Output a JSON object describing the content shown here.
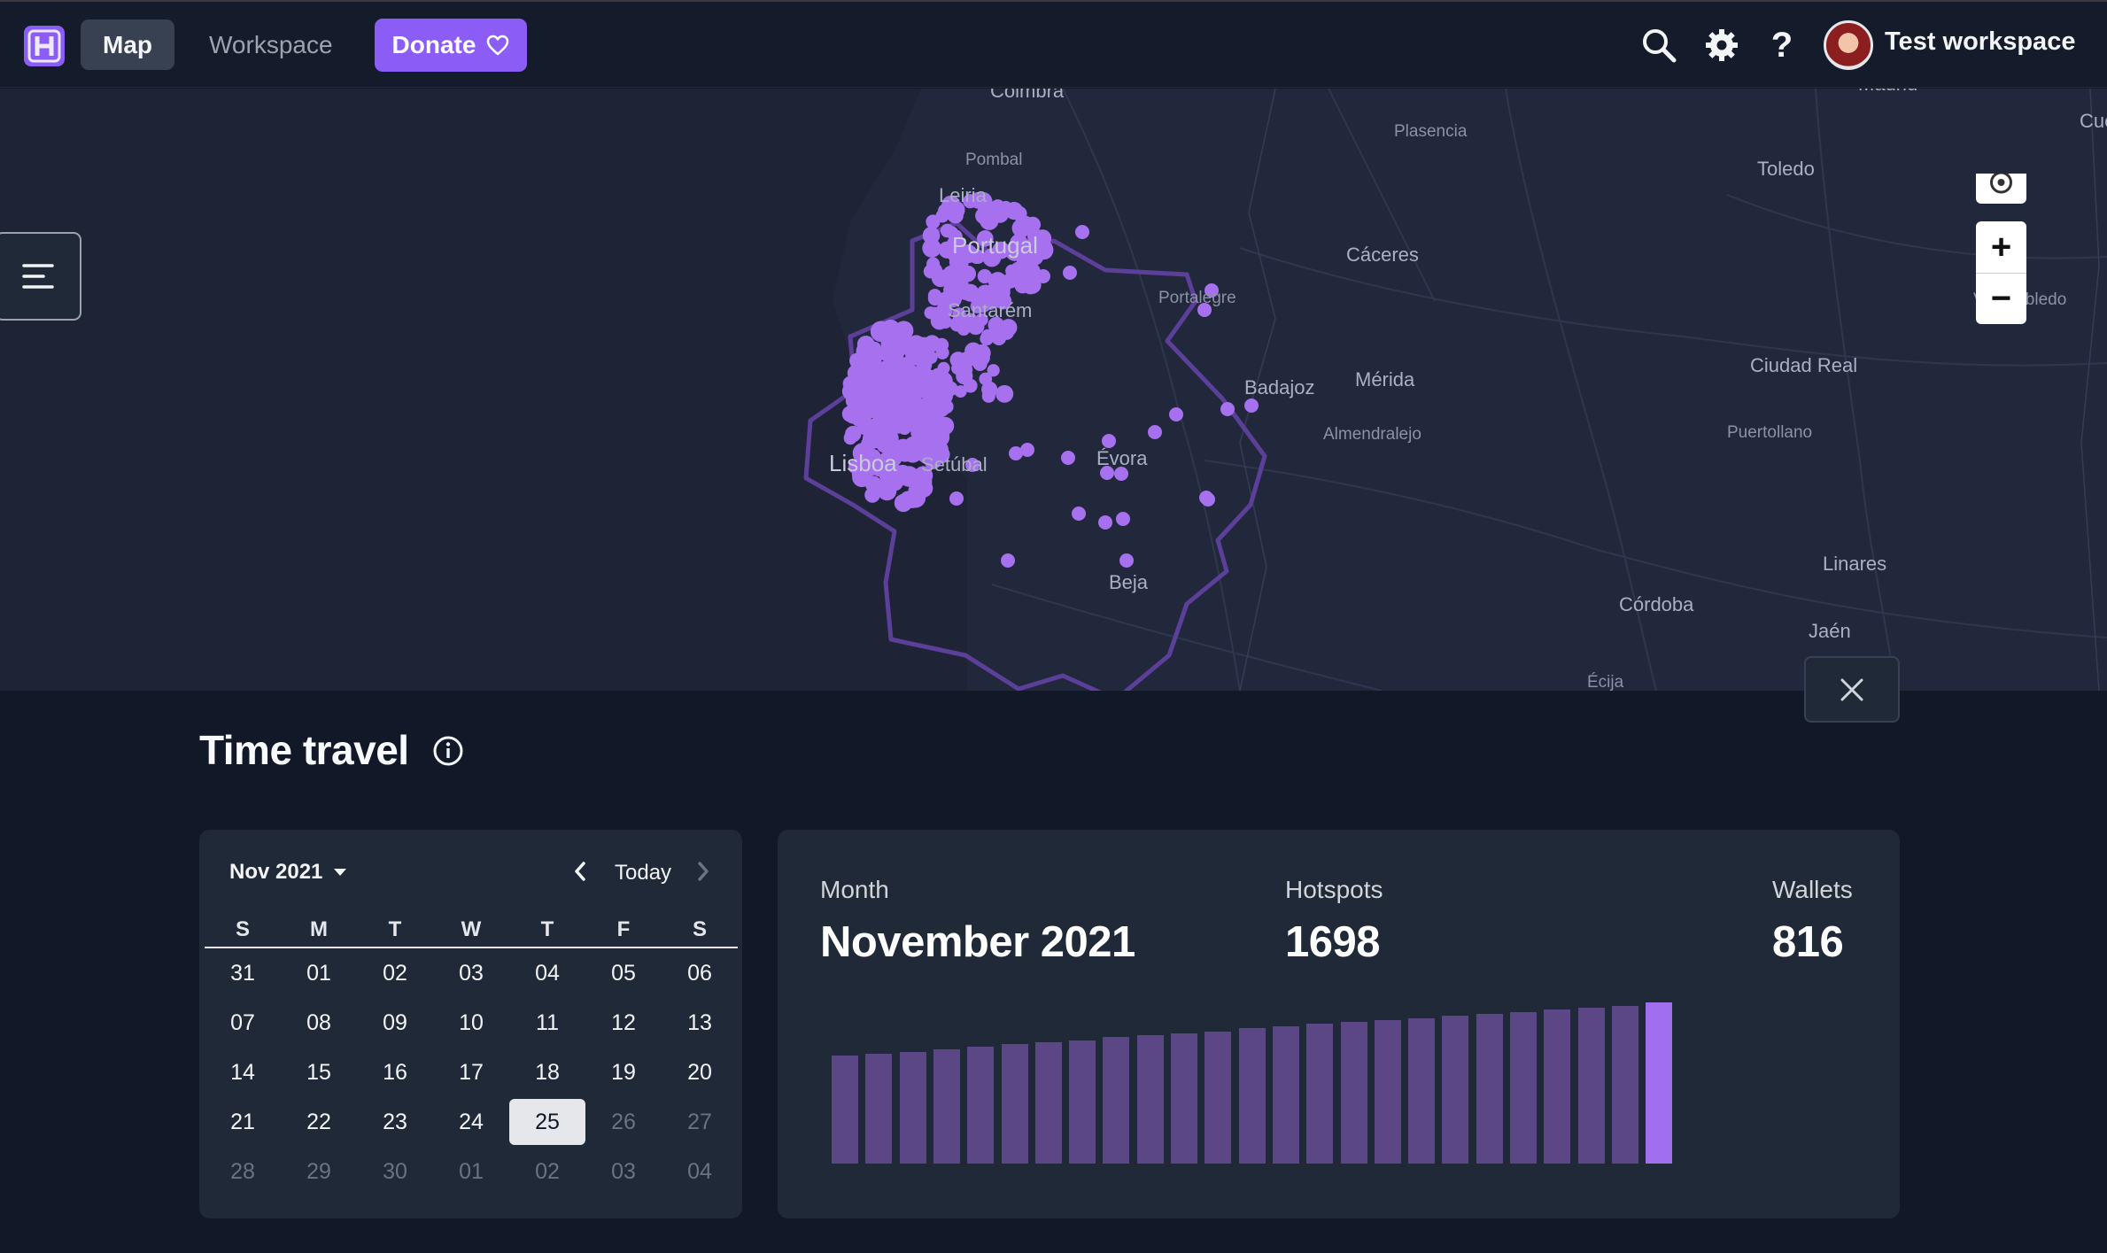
{
  "colors": {
    "accent": "#8b5cf6",
    "bar": "#5b4785",
    "bar_current": "#a06ff0",
    "hex_outline": "#5b3f99",
    "hotspot": "#a670ef"
  },
  "topbar": {
    "logo_icon": "helium-h-logo",
    "nav": {
      "map_label": "Map",
      "workspace_label": "Workspace",
      "donate_label": "Donate"
    },
    "icons": [
      "search-icon",
      "gear-icon",
      "help-icon"
    ],
    "workspace_name": "Test workspace"
  },
  "map": {
    "cities": [
      {
        "name": "Coimbra",
        "cls": ""
      },
      {
        "name": "Pombal",
        "cls": "small"
      },
      {
        "name": "Leiria",
        "cls": ""
      },
      {
        "name": "Portugal",
        "cls": "big"
      },
      {
        "name": "Santarém",
        "cls": ""
      },
      {
        "name": "Portalegre",
        "cls": "small"
      },
      {
        "name": "Lisboa",
        "cls": "big"
      },
      {
        "name": "Setúbal",
        "cls": ""
      },
      {
        "name": "Évora",
        "cls": ""
      },
      {
        "name": "Beja",
        "cls": ""
      },
      {
        "name": "Plasencia",
        "cls": "small"
      },
      {
        "name": "Cáceres",
        "cls": ""
      },
      {
        "name": "Badajoz",
        "cls": ""
      },
      {
        "name": "Mérida",
        "cls": ""
      },
      {
        "name": "Almendralejo",
        "cls": "small"
      },
      {
        "name": "Toledo",
        "cls": ""
      },
      {
        "name": "Madrid",
        "cls": ""
      },
      {
        "name": "Villarrobledo",
        "cls": "small"
      },
      {
        "name": "Ciudad Real",
        "cls": ""
      },
      {
        "name": "Puertollano",
        "cls": "small"
      },
      {
        "name": "Linares",
        "cls": ""
      },
      {
        "name": "Córdoba",
        "cls": ""
      },
      {
        "name": "Jaén",
        "cls": ""
      },
      {
        "name": "Écija",
        "cls": "small"
      },
      {
        "name": "Cuenca",
        "cls": ""
      }
    ],
    "zoom_in_label": "+",
    "zoom_out_label": "−"
  },
  "time_travel": {
    "title": "Time travel",
    "calendar": {
      "month_label": "Nov 2021",
      "today_label": "Today",
      "weekdays": [
        "S",
        "M",
        "T",
        "W",
        "T",
        "F",
        "S"
      ],
      "weeks": [
        [
          {
            "d": "31",
            "m": false
          },
          {
            "d": "01",
            "m": false
          },
          {
            "d": "02",
            "m": false
          },
          {
            "d": "03",
            "m": false
          },
          {
            "d": "04",
            "m": false
          },
          {
            "d": "05",
            "m": false
          },
          {
            "d": "06",
            "m": false
          }
        ],
        [
          {
            "d": "07",
            "m": false
          },
          {
            "d": "08",
            "m": false
          },
          {
            "d": "09",
            "m": false
          },
          {
            "d": "10",
            "m": false
          },
          {
            "d": "11",
            "m": false
          },
          {
            "d": "12",
            "m": false
          },
          {
            "d": "13",
            "m": false
          }
        ],
        [
          {
            "d": "14",
            "m": false
          },
          {
            "d": "15",
            "m": false
          },
          {
            "d": "16",
            "m": false
          },
          {
            "d": "17",
            "m": false
          },
          {
            "d": "18",
            "m": false
          },
          {
            "d": "19",
            "m": false
          },
          {
            "d": "20",
            "m": false
          }
        ],
        [
          {
            "d": "21",
            "m": false
          },
          {
            "d": "22",
            "m": false
          },
          {
            "d": "23",
            "m": false
          },
          {
            "d": "24",
            "m": false
          },
          {
            "d": "25",
            "m": false,
            "sel": true
          },
          {
            "d": "26",
            "m": true
          },
          {
            "d": "27",
            "m": true
          }
        ],
        [
          {
            "d": "28",
            "m": true
          },
          {
            "d": "29",
            "m": true
          },
          {
            "d": "30",
            "m": true
          },
          {
            "d": "01",
            "m": true
          },
          {
            "d": "02",
            "m": true
          },
          {
            "d": "03",
            "m": true
          },
          {
            "d": "04",
            "m": true
          }
        ]
      ]
    },
    "stats": {
      "month_label": "Month",
      "month_value": "November 2021",
      "hotspots_label": "Hotspots",
      "hotspots_value": "1698",
      "wallets_label": "Wallets",
      "wallets_value": "816"
    }
  },
  "chart_data": {
    "type": "bar",
    "values": [
      1646,
      1648,
      1650,
      1652,
      1655,
      1657,
      1659,
      1661,
      1664,
      1666,
      1668,
      1670,
      1673,
      1675,
      1677,
      1679,
      1681,
      1683,
      1685,
      1687,
      1689,
      1691,
      1693,
      1695,
      1698
    ],
    "highlight_last": true,
    "ylim": [
      1540,
      1700
    ],
    "title": "",
    "xlabel": "",
    "ylabel": ""
  }
}
